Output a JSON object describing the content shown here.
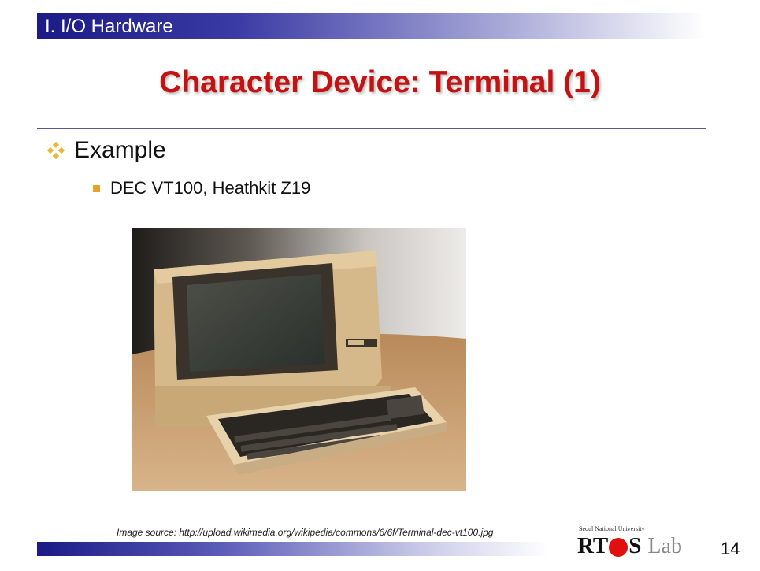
{
  "header": {
    "section_label": "I. I/O Hardware"
  },
  "slide": {
    "title": "Character Device: Terminal (1)",
    "bullets": [
      {
        "text": "Example",
        "sub": [
          {
            "text": "DEC VT100, Heathkit Z19"
          }
        ]
      }
    ],
    "image_caption": "Image source: http://upload.wikimedia.org/wikipedia/commons/6/6f/Terminal-dec-vt100.jpg"
  },
  "footer": {
    "logo_university": "Seoul National University",
    "logo_name_prefix": "RT",
    "logo_name_suffix": "S",
    "logo_lab": "Lab",
    "page_number": "14"
  },
  "colors": {
    "title": "#c41212",
    "header_bar": "#1b1a86",
    "bullet": "#e8a228",
    "logo_dot": "#e01010"
  }
}
